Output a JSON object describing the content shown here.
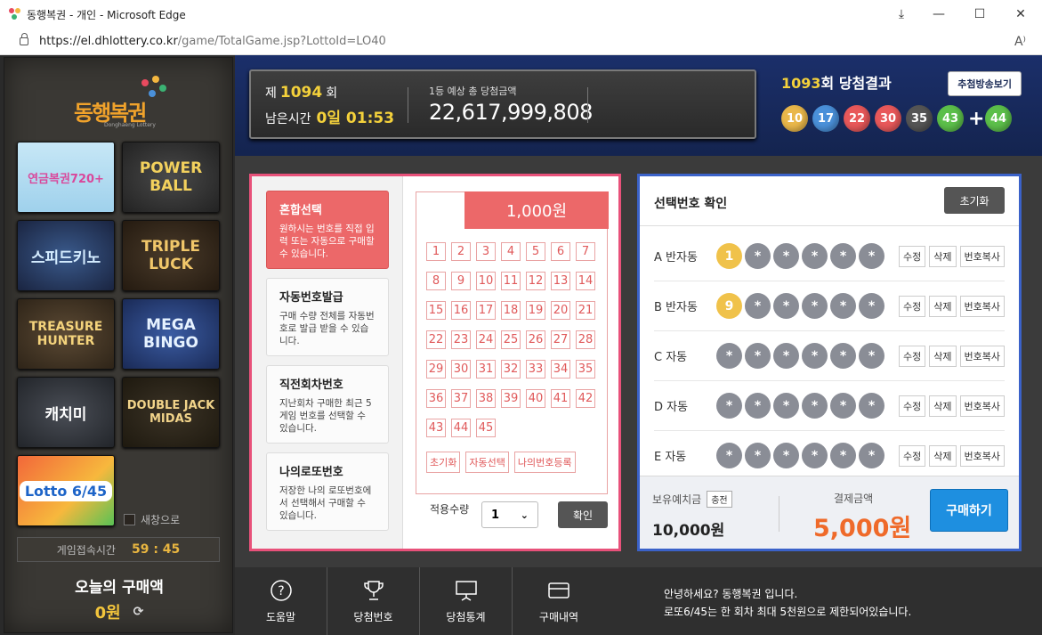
{
  "window": {
    "title": "동행복권 - 개인 - Microsoft Edge",
    "url_host": "https://el.dhlottery.co.kr",
    "url_path": "/game/TotalGame.jsp?LottoId=LO40"
  },
  "sidebar": {
    "brand": "동행복권",
    "brand_sub": "Donghaeng Lottery",
    "games": [
      {
        "name": "연금복권720+",
        "label": "연금복권720+"
      },
      {
        "name": "파워볼",
        "label": "POWER BALL"
      },
      {
        "name": "스피드키노",
        "label": "스피드키노"
      },
      {
        "name": "트리플럭",
        "label": "TRIPLE LUCK"
      },
      {
        "name": "트레져헌터",
        "label": "TREASURE HUNTER"
      },
      {
        "name": "메가빙고",
        "label": "MEGA BINGO"
      },
      {
        "name": "캐치미",
        "label": "캐치미"
      },
      {
        "name": "더블잭마이더스",
        "label": "DOUBLE JACK MIDAS"
      },
      {
        "name": "로또6/45",
        "label": "Lotto 6/45"
      }
    ],
    "new_window_label": "새창으로",
    "session_label": "게임접속시간",
    "session_time": "59 : 45",
    "today_label": "오늘의 구매액",
    "today_amount": "0원"
  },
  "header": {
    "draw_prefix": "제",
    "draw_no": "1094",
    "draw_suffix": "회",
    "remain_label": "남은시간",
    "remain_value": "0일 01:53",
    "prize_label": "1등 예상 총 당첨금액",
    "prize_value": "22,617,999,808",
    "result_draw": "1093",
    "result_label": "회 당첨결과",
    "replay_button": "추첨방송보기",
    "balls": [
      {
        "n": "10",
        "color": "#e9b74a"
      },
      {
        "n": "17",
        "color": "#4a90d9"
      },
      {
        "n": "22",
        "color": "#e8585a"
      },
      {
        "n": "30",
        "color": "#e8585a"
      },
      {
        "n": "35",
        "color": "#555555"
      },
      {
        "n": "43",
        "color": "#5cbf4a"
      }
    ],
    "bonus": {
      "n": "44",
      "color": "#5cbf4a"
    }
  },
  "menu": [
    {
      "title": "혼합선택",
      "desc": "원하시는 번호를 직접 입력 또는 자동으로 구매할 수 있습니다.",
      "active": true
    },
    {
      "title": "자동번호발급",
      "desc": "구매 수량 전체를 자동번호로 발급 받을 수 있습니다.",
      "active": false
    },
    {
      "title": "직전회차번호",
      "desc": "지난회차 구매한 최근 5게임 번호를 선택할 수 있습니다.",
      "active": false
    },
    {
      "title": "나의로또번호",
      "desc": "저장한 나의 로또번호에서 선택해서 구매할 수 있습니다.",
      "active": false
    }
  ],
  "grid": {
    "price": "1,000원",
    "buttons": [
      "초기화",
      "자동선택",
      "나의번호등록"
    ],
    "qty_label": "적용수량",
    "qty_value": "1",
    "apply": "확인"
  },
  "confirm": {
    "title": "선택번호 확인",
    "reset": "초기화",
    "slots": [
      {
        "label": "A 반자동",
        "balls": [
          "1",
          "*",
          "*",
          "*",
          "*",
          "*"
        ]
      },
      {
        "label": "B 반자동",
        "balls": [
          "9",
          "*",
          "*",
          "*",
          "*",
          "*"
        ]
      },
      {
        "label": "C 자동",
        "balls": [
          "*",
          "*",
          "*",
          "*",
          "*",
          "*"
        ]
      },
      {
        "label": "D 자동",
        "balls": [
          "*",
          "*",
          "*",
          "*",
          "*",
          "*"
        ]
      },
      {
        "label": "E 자동",
        "balls": [
          "*",
          "*",
          "*",
          "*",
          "*",
          "*"
        ]
      }
    ],
    "actions": [
      "수정",
      "삭제",
      "번호복사"
    ],
    "deposit_label": "보유예치금",
    "charge": "충전",
    "deposit_value": "10,000원",
    "pay_label": "결제금액",
    "pay_value": "5,000원",
    "buy": "구매하기"
  },
  "footer": {
    "nav": [
      "도움말",
      "당첨번호",
      "당첨통계",
      "구매내역"
    ],
    "msg1": "안녕하세요? 동행복권 입니다.",
    "msg2": "로또6/45는 한 회차 최대 5천원으로 제한되어있습니다."
  }
}
